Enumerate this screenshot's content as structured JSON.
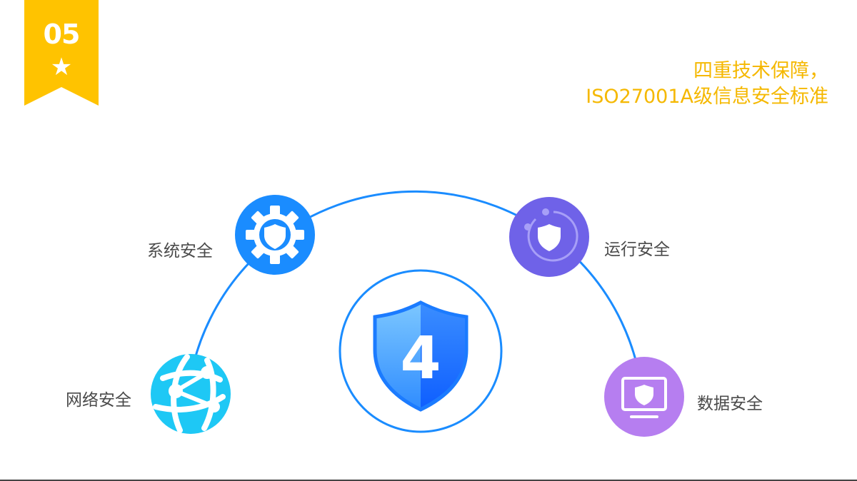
{
  "badge": {
    "number": "05",
    "icon": "star-icon",
    "color": "#ffc300"
  },
  "headline": {
    "line1": "四重技术保障，",
    "line2": "ISO27001A级信息安全标准",
    "color": "#f5b800"
  },
  "center": {
    "value": "4",
    "icon": "shield-icon"
  },
  "nodes": [
    {
      "label": "网络安全",
      "icon": "globe-network-icon",
      "color": "#1ec8f5"
    },
    {
      "label": "系统安全",
      "icon": "gear-shield-icon",
      "color": "#1a8cff"
    },
    {
      "label": "运行安全",
      "icon": "rotate-shield-icon",
      "color": "#6f62e8"
    },
    {
      "label": "数据安全",
      "icon": "monitor-shield-icon",
      "color": "#b67ef0"
    }
  ],
  "arc_color": "#1a8cff"
}
